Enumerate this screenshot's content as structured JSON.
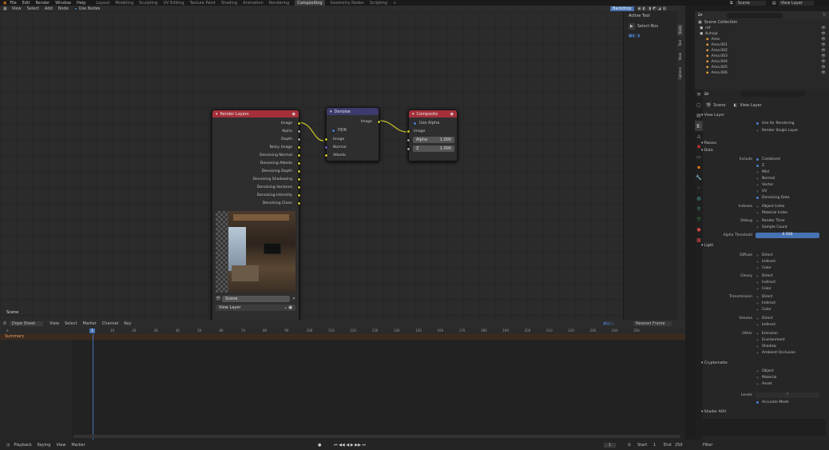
{
  "topbar": {
    "menus": [
      "File",
      "Edit",
      "Render",
      "Window",
      "Help"
    ],
    "workspaces": [
      "Layout",
      "Modeling",
      "Sculpting",
      "UV Editing",
      "Texture Paint",
      "Shading",
      "Animation",
      "Rendering",
      "Compositing",
      "Geometry Nodes",
      "Scripting"
    ],
    "active_workspace": "Compositing",
    "add_tab": "+",
    "scene_label": "Scene",
    "view_layer_label": "View Layer"
  },
  "editor_header": {
    "menus": [
      "View",
      "Select",
      "Add",
      "Node"
    ],
    "use_nodes_label": "Use Nodes",
    "backdrop_label": "Backdrop"
  },
  "sidebar_panel": {
    "title": "Active Tool",
    "select_box": "Select Box",
    "tabs": [
      "Node",
      "Tool",
      "View",
      "Options"
    ]
  },
  "nodes": {
    "render_layers": {
      "title": "Render Layers",
      "outputs": [
        "Image",
        "Alpha",
        "Depth",
        "Noisy Image",
        "Denoising Normal",
        "Denoising Albedo",
        "Denoising Depth",
        "Denoising Shadowing",
        "Denoising Variance",
        "Denoising Intensity",
        "Denoising Clean"
      ],
      "scene": "Scene",
      "layer": "View Layer"
    },
    "denoise": {
      "title": "Denoise",
      "output": "Image",
      "hdr_label": "HDR",
      "inputs": [
        "Image",
        "Normal",
        "Albedo"
      ]
    },
    "composite": {
      "title": "Composite",
      "use_alpha_label": "Use Alpha",
      "input_image": "Image",
      "alpha_label": "Alpha",
      "alpha_value": "1.000",
      "z_label": "Z",
      "z_value": "1.000"
    }
  },
  "editor_scene_label": "Scene",
  "dopesheet": {
    "mode": "Dope Sheet",
    "menus": [
      "View",
      "Select",
      "Marker",
      "Channel",
      "Key"
    ],
    "keying": "Nearest Frame",
    "current_frame": "1",
    "ticks": [
      "10",
      "20",
      "30",
      "40",
      "50",
      "60",
      "70",
      "80",
      "90",
      "100",
      "110",
      "120",
      "130",
      "140",
      "150",
      "160",
      "170",
      "180",
      "190",
      "200",
      "210",
      "220",
      "230",
      "240",
      "250"
    ],
    "summary_label": "Summary"
  },
  "timeline_bar": {
    "menus": [
      "Playback",
      "Keying",
      "View",
      "Marker"
    ],
    "frame": "1",
    "start_label": "Start",
    "start_value": "1",
    "end_label": "End",
    "end_value": "250"
  },
  "outliner": {
    "root": "Scene Collection",
    "items": [
      "ref",
      "Kuhnja",
      "Area",
      "Area.001",
      "Area.002",
      "Area.003",
      "Area.004",
      "Area.005",
      "Area.006"
    ]
  },
  "properties": {
    "breadcrumb_scene": "Scene",
    "breadcrumb_layer": "View Layer",
    "view_layer_section": "View Layer",
    "use_for_rendering": "Use for Rendering",
    "render_single_layer": "Render Single Layer",
    "passes_section": "Passes",
    "data_section": "Data",
    "include_label": "Include",
    "include_items": [
      "Combined",
      "Z",
      "Mist",
      "Normal",
      "Vector",
      "UV",
      "Denoising Data"
    ],
    "include_checked": [
      true,
      true,
      false,
      false,
      false,
      false,
      true
    ],
    "indexes_label": "Indexes",
    "indexes_items": [
      "Object Index",
      "Material Index"
    ],
    "debug_label": "Debug",
    "debug_items": [
      "Render Time",
      "Sample Count"
    ],
    "alpha_threshold_label": "Alpha Threshold",
    "alpha_threshold_value": "0.500",
    "light_section": "Light",
    "diffuse_label": "Diffuse",
    "diffuse_items": [
      "Direct",
      "Indirect",
      "Color"
    ],
    "glossy_label": "Glossy",
    "glossy_items": [
      "Direct",
      "Indirect",
      "Color"
    ],
    "transmission_label": "Transmission",
    "transmission_items": [
      "Direct",
      "Indirect",
      "Color"
    ],
    "volume_label": "Volume",
    "volume_items": [
      "Direct",
      "Indirect"
    ],
    "other_label": "Other",
    "other_items": [
      "Emission",
      "Environment",
      "Shadow",
      "Ambient Occlusion"
    ],
    "cryptomatte_section": "Cryptomatte",
    "crypto_items": [
      "Object",
      "Material",
      "Asset"
    ],
    "levels_label": "Levels",
    "levels_value": "6",
    "accurate_mode": "Accurate Mode",
    "shader_aov_section": "Shader AOV",
    "filter_label": "Filter"
  },
  "colors": {
    "render_layers_header": "#a5303b",
    "denoise_header": "#3b3b6d",
    "composite_header": "#a5303b",
    "socket_color": "#c7c729",
    "socket_vector": "#6363c7",
    "accent": "#4772b3"
  }
}
